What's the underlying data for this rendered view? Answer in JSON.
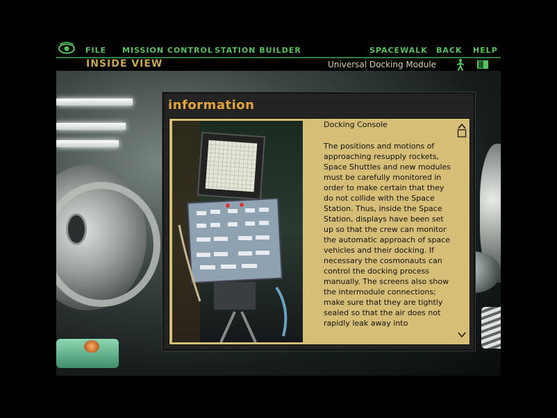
{
  "menu": {
    "file": "FILE",
    "mission_control": "MISSION CONTROL",
    "station_builder": "STATION BUILDER",
    "spacewalk": "SPACEWALK",
    "back": "BACK",
    "help": "HELP"
  },
  "header": {
    "view_title": "INSIDE VIEW",
    "module_name": "Universal Docking Module"
  },
  "dialog": {
    "title": "information",
    "heading": "Docking Console",
    "body": "The positions and motions of approaching resupply rockets, Space Shuttles and new modules must be carefully monitored in order to make certain that they do not collide with the Space Station. Thus, inside the Space Station, displays have been set up so that the crew can monitor the automatic approach of space vehicles and their docking. If necessary the cosmonauts can control the docking process manually. The screens also show the intermodule connections; make sure that they are tightly sealed so that the air does not rapidly leak away into"
  },
  "icons": {
    "logo": "eye-icon",
    "spacewalk_figure": "astronaut-walk-icon",
    "book": "book-icon",
    "scroll_up": "scroll-up-icon",
    "scroll_down": "scroll-down-icon"
  },
  "colors": {
    "menu_text": "#55c25a",
    "view_title": "#c8a84e",
    "dialog_title": "#e2a43a",
    "panel_bg": "#d6be76"
  }
}
